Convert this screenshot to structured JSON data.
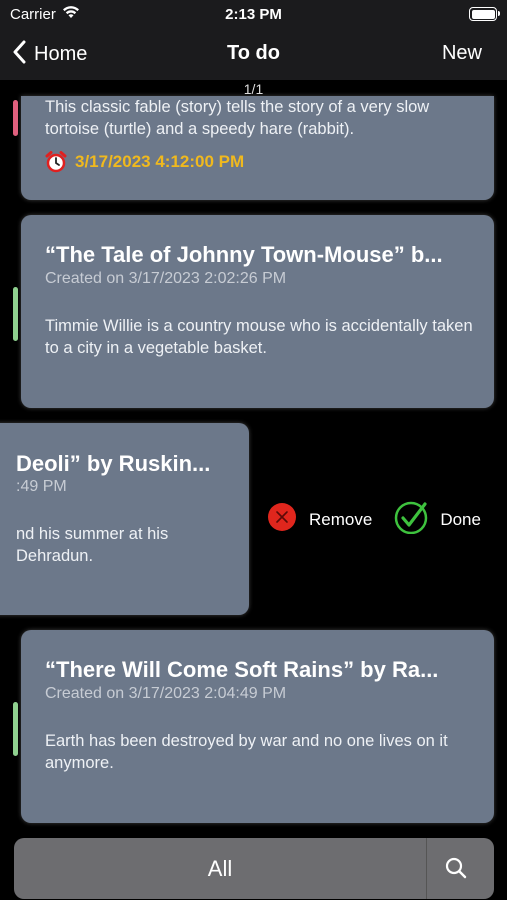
{
  "status": {
    "carrier": "Carrier",
    "time": "2:13 PM"
  },
  "nav": {
    "back_label": "Home",
    "title": "To do",
    "new_label": "New"
  },
  "pager": "1/1",
  "cards": [
    {
      "title": "",
      "created": "",
      "description": "This classic fable (story) tells the story of a very slow tortoise (turtle) and a speedy hare (rabbit).",
      "reminder": "3/17/2023 4:12:00 PM",
      "bar_color": "#e0607e"
    },
    {
      "title": "“The Tale of Johnny Town-Mouse” b...",
      "created": "Created on 3/17/2023 2:02:26 PM",
      "description": "Timmie Willie is a country mouse who is accidentally taken to a city in a vegetable basket.",
      "bar_color": "#8fd08f"
    },
    {
      "title": "Deoli” by Ruskin...",
      "created": ":49 PM",
      "description_line1": "nd his summer at his",
      "description_line2": "Dehradun."
    },
    {
      "title": "“There Will Come Soft Rains” by Ra...",
      "created": "Created on 3/17/2023 2:04:49 PM",
      "description": "Earth has been destroyed by war and no one lives on it anymore.",
      "bar_color": "#8fd08f"
    }
  ],
  "swipe_actions": {
    "remove_label": "Remove",
    "done_label": "Done",
    "remove_color": "#e0261d",
    "done_color": "#3ec23e"
  },
  "filter": {
    "label": "All"
  },
  "icons": {
    "back": "chevron-left-icon",
    "alarm": "alarm-clock-icon",
    "remove": "x-circle-icon",
    "done": "checkmark-circle-icon",
    "search": "search-icon"
  }
}
